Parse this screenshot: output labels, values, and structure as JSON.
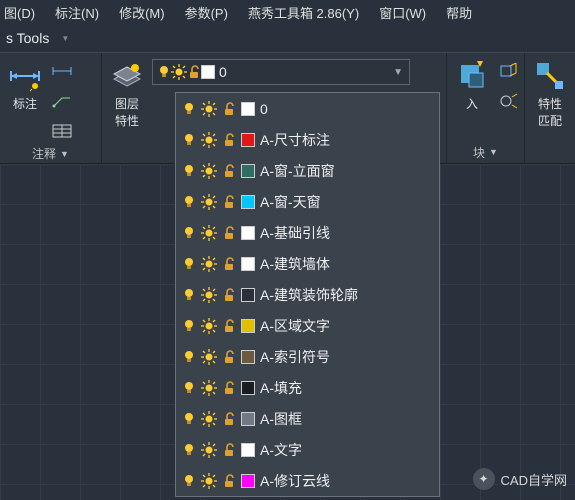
{
  "menu": {
    "draw": "图(D)",
    "annotate": "标注(N)",
    "modify": "修改(M)",
    "param": "参数(P)",
    "yxtool": "燕秀工具箱 2.86(Y)",
    "window": "窗口(W)",
    "help": "帮助"
  },
  "title": "s Tools",
  "ribbon": {
    "annotate": {
      "big": "标注",
      "label": "注释"
    },
    "layerprops": {
      "big": "图层\n特性"
    },
    "insert": {
      "big": "入",
      "label": "块"
    },
    "props": {
      "big": "特性\n匹配"
    }
  },
  "current_layer": {
    "name": "0",
    "color": "#ffffff"
  },
  "layers": [
    {
      "name": "0",
      "color": "#ffffff"
    },
    {
      "name": "A-尺寸标注",
      "color": "#e01818"
    },
    {
      "name": "A-窗-立面窗",
      "color": "#2f6e62"
    },
    {
      "name": "A-窗-天窗",
      "color": "#00c8ff"
    },
    {
      "name": "A-基础引线",
      "color": "#ffffff"
    },
    {
      "name": "A-建筑墙体",
      "color": "#ffffff"
    },
    {
      "name": "A-建筑装饰轮廓",
      "color": "#2a3038"
    },
    {
      "name": "A-区域文字",
      "color": "#e0c000"
    },
    {
      "name": "A-索引符号",
      "color": "#6b5a3e"
    },
    {
      "name": "A-填充",
      "color": "#1a1d22"
    },
    {
      "name": "A-图框",
      "color": "#6f7a84"
    },
    {
      "name": "A-文字",
      "color": "#ffffff"
    },
    {
      "name": "A-修订云线",
      "color": "#ff00ff"
    }
  ],
  "watermark": "CAD自学网"
}
